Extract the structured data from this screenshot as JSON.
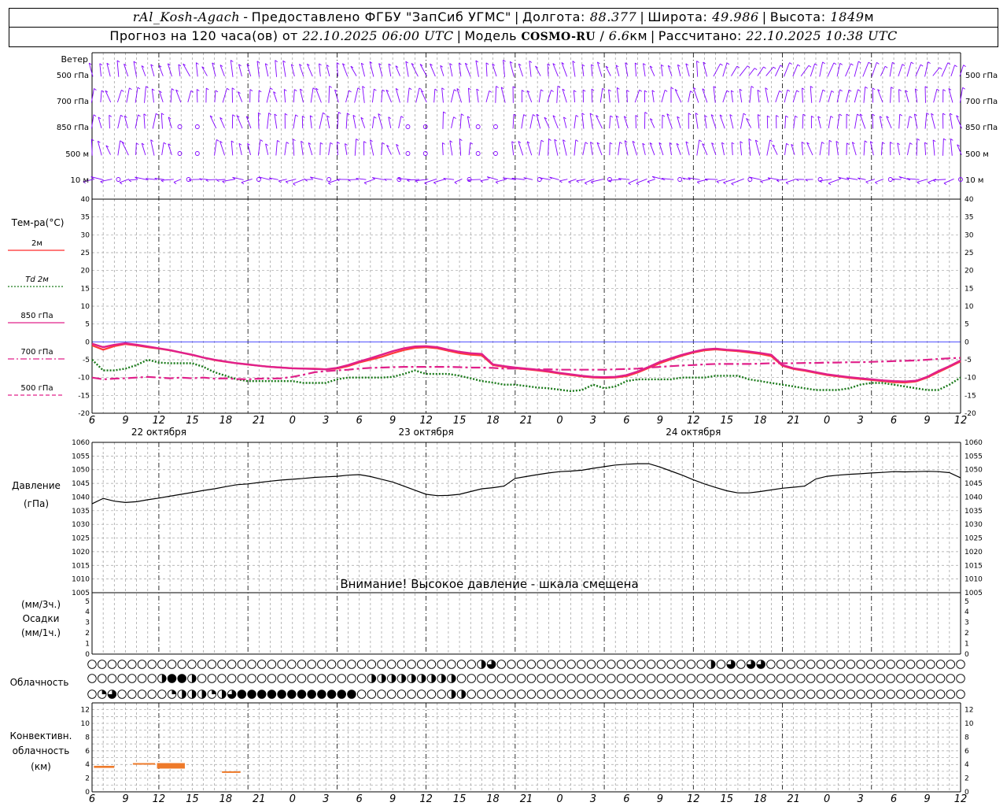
{
  "header": {
    "station": "rAl_Kosh-Agach",
    "provider": "Предоставлено ФГБУ \"ЗапСиб УГМС\"",
    "lon_label": "Долгота:",
    "lon_value": "88.377",
    "lat_label": "Широта:",
    "lat_value": "49.986",
    "alt_label": "Высота:",
    "alt_value": "1849",
    "alt_unit": "м",
    "forecast_prefix": "Прогноз на 120 часа(ов) от",
    "forecast_start": "22.10.2025 06:00 UTC",
    "model_label": "Модель",
    "model_name": "COSMO-RU",
    "model_res": "6.6",
    "model_res_unit": "км",
    "computed_label": "Рассчитано:",
    "computed_value": "22.10.2025 10:38 UTC"
  },
  "wind_panel": {
    "title": "Ветер",
    "levels": [
      "500 гПа",
      "700 гПа",
      "850 гПа",
      "500 м",
      "10  м"
    ],
    "color": "#8000ff"
  },
  "temp_panel": {
    "title": "Тем-ра(°C)",
    "legend": [
      {
        "label": "2м",
        "color": "#ff2a2a",
        "style": "solid"
      },
      {
        "label": "Td  2м",
        "color": "#1a7a1a",
        "style": "dotted"
      },
      {
        "label": "850 гПа",
        "color": "#e0208a",
        "style": "solid"
      },
      {
        "label": "700 гПа",
        "color": "#e0208a",
        "style": "dashdot"
      },
      {
        "label": "500 гПа",
        "color": "#e0208a",
        "style": "dashed"
      }
    ],
    "y_ticks": [
      "40",
      "35",
      "30",
      "25",
      "20",
      "15",
      "10",
      "5",
      "0",
      "-5",
      "-10",
      "-15",
      "-20"
    ]
  },
  "pressure_panel": {
    "title": "Давление",
    "unit": "(гПа)",
    "y_ticks": [
      "1060",
      "1055",
      "1050",
      "1045",
      "1040",
      "1035",
      "1030",
      "1025",
      "1020",
      "1015",
      "1010",
      "1005"
    ],
    "warning": "Внимание! Высокое давление - шкала смещена"
  },
  "precip_panel": {
    "unit_top": "(мм/3ч.)",
    "title": "Осадки",
    "unit_bottom": "(мм/1ч.)",
    "y_ticks": [
      "5",
      "4",
      "3",
      "2",
      "1",
      "0"
    ]
  },
  "cloud_panel": {
    "title": "Облачность"
  },
  "convective_panel": {
    "title_1": "Конвективн.",
    "title_2": "облачность",
    "unit": "(км)",
    "y_ticks": [
      "12",
      "10",
      "8",
      "6",
      "4",
      "2",
      "0"
    ]
  },
  "time_axis": {
    "hour_labels": [
      "6",
      "9",
      "12",
      "15",
      "18",
      "21",
      "0",
      "3",
      "6",
      "9",
      "12",
      "15",
      "18",
      "21",
      "0",
      "3",
      "6",
      "9",
      "12",
      "15",
      "18",
      "21",
      "0",
      "3",
      "6",
      "9",
      "12"
    ],
    "date_labels": [
      "22 октября",
      "23 октября",
      "24 октября"
    ]
  },
  "chart_data": [
    {
      "type": "line",
      "title": "Тем-ра(°C)",
      "x_unit": "hours since 22.10.2025 06:00 UTC",
      "x": [
        0,
        3,
        6,
        9,
        12,
        15,
        18,
        21,
        24,
        27,
        30,
        33,
        36,
        39,
        42,
        45,
        48,
        51,
        54,
        57,
        60,
        63,
        66,
        69,
        72,
        75,
        78,
        81,
        84,
        87,
        90,
        93,
        96,
        99,
        102,
        105,
        108,
        111,
        114,
        117,
        120,
        123,
        126,
        129,
        132,
        135,
        138,
        141,
        144,
        147,
        150,
        153,
        156,
        159,
        162,
        165,
        168,
        171,
        174,
        177,
        180,
        183,
        186,
        189,
        192,
        195,
        198,
        201,
        204,
        207,
        210,
        213,
        216,
        219,
        222,
        225,
        228,
        231,
        234
      ],
      "ylim": [
        -20,
        40
      ],
      "series": [
        {
          "name": "2м",
          "values": [
            -1,
            -2.2,
            -1.2,
            -0.6,
            -1,
            -1.5,
            -1.9,
            -2.4,
            -3,
            -3.7,
            -4.4,
            -5.1,
            -5.6,
            -6,
            -6.4,
            -6.7,
            -7,
            -7.2,
            -7.4,
            -7.5,
            -7.5,
            -7.7,
            -7.5,
            -6.8,
            -5.8,
            -5,
            -4.2,
            -3.2,
            -2.3,
            -1.7,
            -1.5,
            -1.8,
            -2.5,
            -3.2,
            -3.6,
            -3.8,
            -6.5,
            -7,
            -7.4,
            -7.7,
            -8,
            -8.4,
            -8.9,
            -9.3,
            -9.7,
            -10,
            -10.1,
            -10,
            -9.6,
            -8.6,
            -7.3,
            -6,
            -4.9,
            -3.9,
            -3,
            -2.4,
            -2.1,
            -2.4,
            -2.6,
            -3,
            -3.4,
            -4,
            -6.7,
            -7.6,
            -8.1,
            -8.7,
            -9.3,
            -9.7,
            -10.1,
            -10.4,
            -10.7,
            -11,
            -11.3,
            -11.4,
            -11.1,
            -10,
            -8.5,
            -7,
            -5.5
          ]
        },
        {
          "name": "Td  2м",
          "values": [
            -5,
            -8,
            -8,
            -7.5,
            -6.5,
            -5,
            -5.8,
            -6,
            -6,
            -6,
            -7,
            -8.5,
            -9.5,
            -10.5,
            -11,
            -11,
            -11,
            -11,
            -11,
            -11.5,
            -11.5,
            -11.5,
            -10.5,
            -10,
            -10,
            -10,
            -10,
            -9.8,
            -9,
            -8,
            -9,
            -9,
            -9,
            -9.5,
            -10.2,
            -11,
            -11.4,
            -12,
            -12,
            -12.4,
            -12.8,
            -13,
            -13.4,
            -13.8,
            -13.5,
            -12,
            -13,
            -12.5,
            -11,
            -10.5,
            -10.5,
            -10.5,
            -10.5,
            -10,
            -10,
            -10,
            -9.5,
            -9.5,
            -9.5,
            -10.5,
            -11,
            -11.5,
            -12,
            -12.5,
            -13,
            -13.5,
            -13.5,
            -13.5,
            -13,
            -12,
            -11.5,
            -11.5,
            -12,
            -12.5,
            -13,
            -13.5,
            -13.5,
            -12,
            -10
          ]
        },
        {
          "name": "850 гПа",
          "values": [
            -0.5,
            -1.5,
            -0.8,
            -0.4,
            -0.8,
            -1.3,
            -1.8,
            -2.3,
            -3,
            -3.6,
            -4.4,
            -5,
            -5.5,
            -6,
            -6.3,
            -6.7,
            -7,
            -7.2,
            -7.4,
            -7.5,
            -7.6,
            -7.7,
            -7.3,
            -6.5,
            -5.5,
            -4.6,
            -3.6,
            -2.6,
            -1.8,
            -1.3,
            -1.2,
            -1.5,
            -2.2,
            -2.8,
            -3.2,
            -3.4,
            -6.3,
            -6.8,
            -7.2,
            -7.5,
            -7.8,
            -8.2,
            -8.7,
            -9.1,
            -9.5,
            -9.8,
            -9.9,
            -9.8,
            -9.3,
            -8.3,
            -7,
            -5.6,
            -4.6,
            -3.6,
            -2.8,
            -2.1,
            -1.9,
            -2.2,
            -2.4,
            -2.7,
            -3.1,
            -3.6,
            -6.5,
            -7.4,
            -7.9,
            -8.5,
            -9.1,
            -9.5,
            -9.9,
            -10.2,
            -10.5,
            -10.8,
            -11,
            -11.1,
            -10.9,
            -9.8,
            -8.2,
            -6.8,
            -5.2
          ]
        },
        {
          "name": "700 гПа",
          "values": [
            -10,
            -10.5,
            -10.3,
            -10.2,
            -10,
            -9.8,
            -10,
            -10.2,
            -10,
            -10.2,
            -10,
            -10.3,
            -10.2,
            -10.4,
            -10.5,
            -10.3,
            -10.3,
            -10.2,
            -9.8,
            -9.2,
            -8.5,
            -8.2,
            -8,
            -7.8,
            -7.5,
            -7.3,
            -7.2,
            -7.1,
            -7,
            -7,
            -7,
            -7,
            -7,
            -7.1,
            -7.2,
            -7.2,
            -7.3,
            -7.5,
            -7.5,
            -7.6,
            -7.7,
            -7.7,
            -7.8,
            -7.8,
            -7.8,
            -7.8,
            -7.8,
            -7.7,
            -7.6,
            -7.5,
            -7.2,
            -7,
            -6.8,
            -6.6,
            -6.5,
            -6.3,
            -6.2,
            -6.2,
            -6.2,
            -6.2,
            -6.1,
            -6,
            -6,
            -6,
            -5.9,
            -5.9,
            -5.8,
            -5.8,
            -5.7,
            -5.7,
            -5.6,
            -5.5,
            -5.4,
            -5.3,
            -5.2,
            -5,
            -4.8,
            -4.6,
            -4.5
          ]
        }
      ]
    },
    {
      "type": "line",
      "title": "Давление",
      "x_unit": "hours since 22.10.2025 06:00 UTC",
      "x": [
        0,
        3,
        6,
        9,
        12,
        15,
        18,
        21,
        24,
        27,
        30,
        33,
        36,
        39,
        42,
        45,
        48,
        51,
        54,
        57,
        60,
        63,
        66,
        69,
        72,
        75,
        78,
        81,
        84,
        87,
        90,
        93,
        96,
        99,
        102,
        105,
        108,
        111,
        114,
        117,
        120,
        123,
        126,
        129,
        132,
        135,
        138,
        141,
        144,
        147,
        150,
        153,
        156,
        159,
        162,
        165,
        168,
        171,
        174,
        177,
        180,
        183,
        186,
        189,
        192,
        195,
        198,
        201,
        204,
        207,
        210,
        213,
        216,
        219,
        222,
        225,
        228,
        231,
        234
      ],
      "ylim": [
        1005,
        1060
      ],
      "series": [
        {
          "name": "Давление",
          "values": [
            1037.5,
            1039.5,
            1038.5,
            1038,
            1038.3,
            1039,
            1039.6,
            1040.3,
            1041,
            1041.7,
            1042.4,
            1043,
            1043.8,
            1044.5,
            1044.8,
            1045.3,
            1045.8,
            1046.2,
            1046.5,
            1046.8,
            1047.2,
            1047.4,
            1047.6,
            1048,
            1048.2,
            1047.5,
            1046.5,
            1045.5,
            1044,
            1042.5,
            1041,
            1040.5,
            1040.6,
            1041,
            1042,
            1043,
            1043.4,
            1044,
            1046.8,
            1047.5,
            1048.2,
            1048.8,
            1049.3,
            1049.5,
            1049.8,
            1050.5,
            1051.1,
            1051.7,
            1052,
            1052.2,
            1052.2,
            1051,
            1049.5,
            1048,
            1046.3,
            1044.8,
            1043.5,
            1042.3,
            1041.5,
            1041.5,
            1042,
            1042.6,
            1043.2,
            1043.6,
            1044,
            1046.6,
            1047.6,
            1048,
            1048.3,
            1048.5,
            1048.8,
            1049,
            1049.3,
            1049.2,
            1049.3,
            1049.4,
            1049.3,
            1048.9,
            1047
          ]
        }
      ]
    },
    {
      "type": "bar",
      "title": "Конвективн. облачность",
      "x_unit": "hours since 22.10.2025 06:00 UTC",
      "ylim": [
        0,
        13
      ],
      "series": [
        {
          "x_start": 0.5,
          "x_end": 6,
          "base_km": 3.5,
          "top_km": 3.8
        },
        {
          "x_start": 11,
          "x_end": 17,
          "base_km": 4,
          "top_km": 4.2
        },
        {
          "x_start": 17.5,
          "x_end": 25,
          "base_km": 3.4,
          "top_km": 4.2
        },
        {
          "x_start": 35,
          "x_end": 40,
          "base_km": 2.8,
          "top_km": 3
        }
      ]
    }
  ],
  "clouds": {
    "row_top": "000000000000000000000000000000000000000000000000000000000000000000000000000000000000000000000000000000000000000000000000000000000000000000000000000000000000000000000000000000000000000000000000000000000000000000000000000000000000",
    "row_middle": "000000000000000000000000000000000000000000000000000000000000000000000000000000000000000000000000000000000000000000000000000000000000000000000000000000000000000000000000000000000000000000000000000000000000000000000000000000000000",
    "row_bottom": "000000000000000000000000000000000000000000000000000000000000000000000000000000000000000000000000000000000000000000000000000000000000000000000000000000000000000000000000000000000000000000000000000000000000000000000000000000000000",
    "cover_top": [
      0,
      0,
      0,
      0,
      0,
      0,
      0,
      0,
      0,
      0,
      0,
      0,
      0,
      0,
      0,
      0,
      0,
      0,
      0,
      0,
      0,
      0,
      0,
      0,
      0,
      0,
      0,
      0,
      0,
      0,
      0,
      0,
      0,
      0,
      0,
      0,
      0,
      0,
      0,
      0,
      0,
      0,
      0,
      0,
      0,
      0,
      0,
      0,
      0,
      0,
      0,
      0,
      0,
      0,
      0,
      0,
      0,
      0,
      0,
      0,
      0,
      0,
      0,
      0,
      0,
      0,
      0,
      0,
      0,
      0,
      0,
      0,
      0,
      0,
      0,
      0,
      0,
      0,
      0,
      0,
      0,
      0,
      0,
      0,
      0,
      0,
      0,
      0,
      0,
      0,
      0,
      0,
      0,
      0,
      0,
      0,
      0,
      0,
      0,
      0,
      0,
      0,
      0,
      0,
      0,
      0,
      0,
      0,
      0,
      0,
      0,
      0,
      0,
      0,
      0,
      0,
      0,
      0,
      0,
      0,
      0
    ],
    "cover_middle": [
      0,
      0,
      0,
      0,
      0,
      0,
      0,
      0,
      0,
      0,
      0,
      0,
      0,
      0,
      0,
      0,
      0,
      0,
      0,
      0,
      0,
      0,
      0,
      0,
      0,
      0,
      0,
      0,
      0,
      0,
      0,
      0,
      0,
      0,
      0,
      0,
      0,
      0,
      0,
      0,
      0,
      0,
      0,
      0,
      0,
      0,
      0,
      0,
      0,
      0,
      0,
      0,
      0,
      0,
      0,
      0,
      0,
      0,
      0,
      0,
      0,
      0,
      0,
      0,
      0,
      0,
      0,
      0,
      0,
      0,
      0,
      0,
      0,
      0,
      0,
      0,
      0,
      0,
      0,
      0,
      0,
      0,
      0,
      0,
      0,
      0,
      0,
      0,
      0,
      0,
      0,
      0,
      0,
      0,
      0,
      0,
      0,
      0,
      0,
      0,
      0,
      0,
      0,
      0,
      0,
      0,
      0,
      0,
      0,
      0,
      0,
      0,
      0,
      0,
      0,
      0,
      0,
      0,
      0,
      0,
      0
    ],
    "cover_bottom": [
      0,
      0,
      0,
      0,
      0,
      0,
      0,
      0,
      0,
      0,
      0,
      0,
      0,
      0,
      0,
      0,
      0,
      0,
      0,
      0,
      0,
      0,
      0,
      0,
      0,
      0,
      0,
      0,
      0,
      0,
      0,
      0,
      0,
      0,
      0,
      0,
      0,
      0,
      0,
      0,
      0,
      0,
      0,
      0,
      0,
      0,
      0,
      0,
      0,
      0,
      0,
      0,
      0,
      0,
      0,
      0,
      0,
      0,
      0,
      0,
      0,
      0,
      0,
      0,
      0,
      0,
      0,
      0,
      0,
      0,
      0,
      0,
      0,
      0,
      0,
      0,
      0,
      0,
      0,
      0,
      0,
      0,
      0,
      0,
      0,
      0,
      0,
      0,
      0,
      0,
      0,
      0,
      0,
      0,
      0,
      0,
      0,
      0,
      0,
      0,
      0,
      0,
      0,
      0,
      0,
      0,
      0,
      0,
      0,
      0,
      0,
      0,
      0,
      0,
      0,
      0,
      0,
      0,
      0,
      0,
      0
    ]
  },
  "cloud_cover_fractions": {
    "top": {
      "39": 0.5,
      "40": 0.75,
      "62": 0.5,
      "64": 0.75,
      "66": 0.75,
      "67": 0.75
    },
    "middle": {
      "7": 0.5,
      "8": 1,
      "9": 1,
      "10": 0.5,
      "28": 0.5,
      "29": 0.5,
      "30": 0.5,
      "31": 0.5,
      "32": 0.5,
      "33": 0.5,
      "34": 0.5,
      "35": 0.5,
      "36": 0.5
    },
    "bottom": {
      "1": 0.25,
      "2": 0.75,
      "8": 0.25,
      "9": 0.5,
      "10": 0.5,
      "11": 0.5,
      "12": 0.25,
      "13": 0.5,
      "14": 0.75,
      "15": 1,
      "16": 1,
      "17": 1,
      "18": 1,
      "19": 1,
      "20": 1,
      "21": 1,
      "22": 1,
      "23": 1,
      "24": 1,
      "25": 1,
      "26": 1,
      "36": 0.5,
      "37": 0.5
    }
  }
}
